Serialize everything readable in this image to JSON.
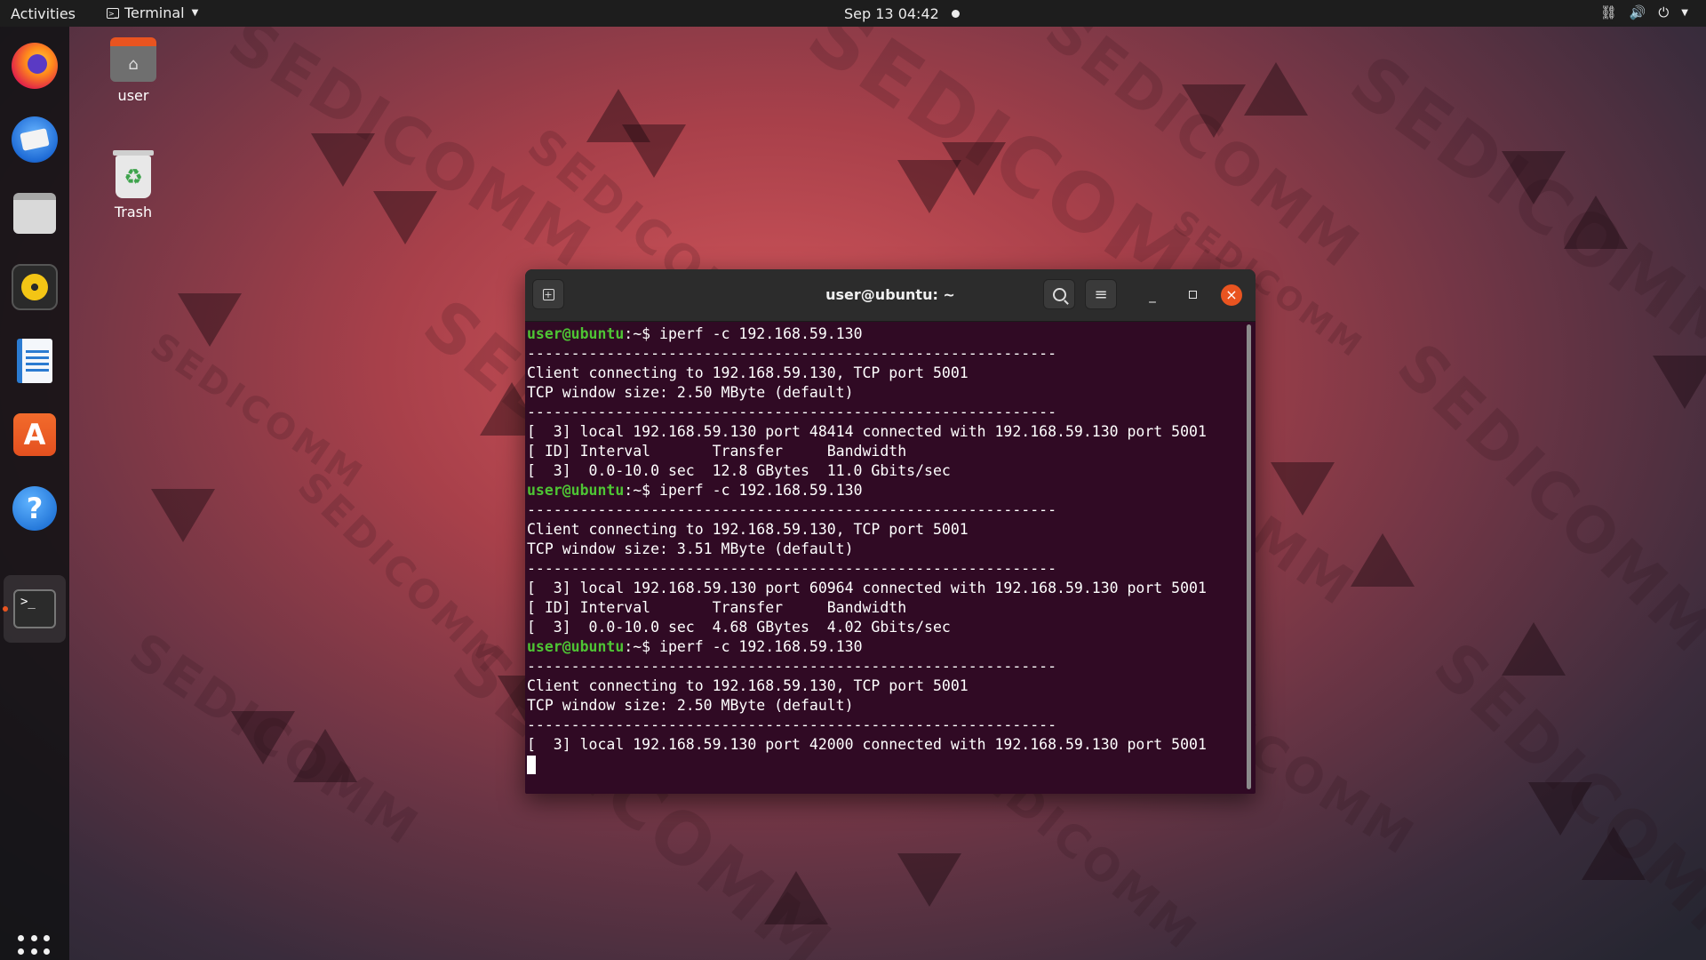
{
  "topbar": {
    "activities": "Activities",
    "app_name": "Terminal",
    "clock": "Sep 13  04:42"
  },
  "dock": {
    "apps": [
      "Firefox",
      "Thunderbird",
      "Files",
      "Rhythmbox",
      "LibreOffice Writer",
      "Ubuntu Software",
      "Help",
      "Terminal"
    ],
    "running": "Terminal",
    "accent": "#e95420"
  },
  "desktop": {
    "watermark": "SEDICOMM",
    "icons": [
      {
        "label": "user",
        "icon": "home-folder-icon"
      },
      {
        "label": "Trash",
        "icon": "trash-icon"
      }
    ]
  },
  "terminal": {
    "title": "user@ubuntu: ~",
    "prompt_user": "user@ubuntu",
    "prompt_path": ":~$ ",
    "prompt_color": "#4ec434",
    "background": "#300a24",
    "lines": [
      {
        "type": "cmd",
        "text": "iperf -c 192.168.59.130"
      },
      {
        "type": "out",
        "text": "------------------------------------------------------------"
      },
      {
        "type": "out",
        "text": "Client connecting to 192.168.59.130, TCP port 5001"
      },
      {
        "type": "out",
        "text": "TCP window size: 2.50 MByte (default)"
      },
      {
        "type": "out",
        "text": "------------------------------------------------------------"
      },
      {
        "type": "out",
        "text": "[  3] local 192.168.59.130 port 48414 connected with 192.168.59.130 port 5001"
      },
      {
        "type": "out",
        "text": "[ ID] Interval       Transfer     Bandwidth"
      },
      {
        "type": "out",
        "text": "[  3]  0.0-10.0 sec  12.8 GBytes  11.0 Gbits/sec"
      },
      {
        "type": "cmd",
        "text": "iperf -c 192.168.59.130"
      },
      {
        "type": "out",
        "text": "------------------------------------------------------------"
      },
      {
        "type": "out",
        "text": "Client connecting to 192.168.59.130, TCP port 5001"
      },
      {
        "type": "out",
        "text": "TCP window size: 3.51 MByte (default)"
      },
      {
        "type": "out",
        "text": "------------------------------------------------------------"
      },
      {
        "type": "out",
        "text": "[  3] local 192.168.59.130 port 60964 connected with 192.168.59.130 port 5001"
      },
      {
        "type": "out",
        "text": "[ ID] Interval       Transfer     Bandwidth"
      },
      {
        "type": "out",
        "text": "[  3]  0.0-10.0 sec  4.68 GBytes  4.02 Gbits/sec"
      },
      {
        "type": "cmd",
        "text": "iperf -c 192.168.59.130"
      },
      {
        "type": "out",
        "text": "------------------------------------------------------------"
      },
      {
        "type": "out",
        "text": "Client connecting to 192.168.59.130, TCP port 5001"
      },
      {
        "type": "out",
        "text": "TCP window size: 2.50 MByte (default)"
      },
      {
        "type": "out",
        "text": "------------------------------------------------------------"
      },
      {
        "type": "out",
        "text": "[  3] local 192.168.59.130 port 42000 connected with 192.168.59.130 port 5001"
      },
      {
        "type": "cursor",
        "text": ""
      }
    ]
  }
}
